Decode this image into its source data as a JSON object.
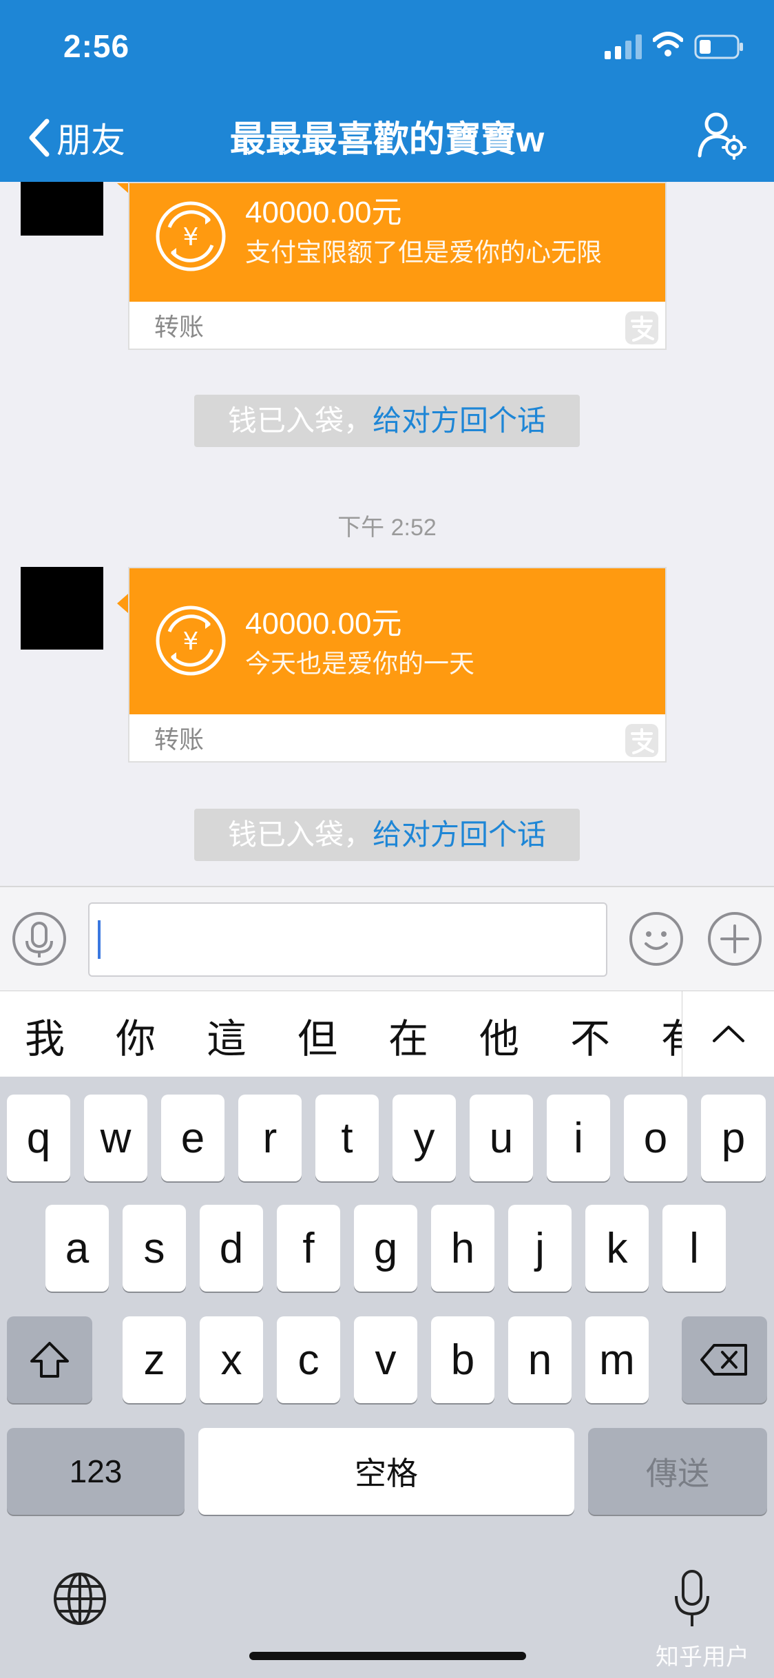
{
  "status_bar": {
    "time": "2:56"
  },
  "nav": {
    "back_label": "朋友",
    "title": "最最最喜歡的寶寶w"
  },
  "chat": {
    "transfers": [
      {
        "amount": "40000.00元",
        "message": "支付宝限额了但是爱你的心无限",
        "label": "转账"
      },
      {
        "amount": "40000.00元",
        "message": "今天也是爱你的一天",
        "label": "转账"
      }
    ],
    "system_messages": [
      {
        "text": "钱已入袋，",
        "link": "给对方回个话"
      },
      {
        "text": "钱已入袋，",
        "link": "给对方回个话"
      }
    ],
    "timestamp": "下午 2:52"
  },
  "input": {
    "value": ""
  },
  "candidates": [
    "我",
    "你",
    "這",
    "但",
    "在",
    "他",
    "不",
    "有"
  ],
  "keyboard": {
    "row1": [
      "q",
      "w",
      "e",
      "r",
      "t",
      "y",
      "u",
      "i",
      "o",
      "p"
    ],
    "row2": [
      "a",
      "s",
      "d",
      "f",
      "g",
      "h",
      "j",
      "k",
      "l"
    ],
    "row3": [
      "z",
      "x",
      "c",
      "v",
      "b",
      "n",
      "m"
    ],
    "numbers_label": "123",
    "space_label": "空格",
    "send_label": "傳送"
  },
  "watermark": "知乎用户",
  "colors": {
    "header": "#1e86d6",
    "transfer_orange": "#ff9a10",
    "link_blue": "#1e86d6"
  }
}
